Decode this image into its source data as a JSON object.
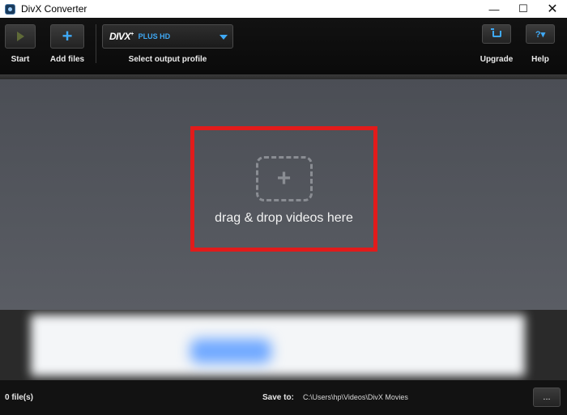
{
  "window": {
    "title": "DivX Converter",
    "minimize": "—",
    "maximize": "☐",
    "close": "✕"
  },
  "toolbar": {
    "start_label": "Start",
    "add_files_label": "Add files",
    "profile": {
      "logo_text": "DIVX",
      "logo_sup": "+",
      "value": "PLUS HD",
      "label": "Select output profile"
    },
    "upgrade_label": "Upgrade",
    "help_label": "Help",
    "help_glyph": "?▾"
  },
  "main": {
    "drop_glyph": "+",
    "drop_text": "drag & drop videos here"
  },
  "status": {
    "file_count": "0 file(s)",
    "save_to_label": "Save to:",
    "save_path": "C:\\Users\\hp\\Videos\\DivX Movies",
    "browse_label": "..."
  },
  "colors": {
    "accent": "#3fa9f5",
    "highlight": "#e21b1b",
    "background": "#4b4e55"
  },
  "icons": {
    "app": "divx-app-icon",
    "start": "play-icon",
    "add": "plus-icon",
    "upgrade": "cart-icon",
    "help": "question-icon"
  }
}
